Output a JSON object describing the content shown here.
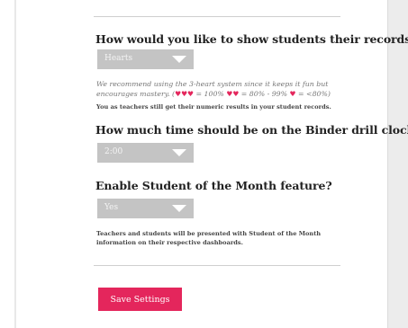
{
  "records": {
    "question": "How would you like to show students their records?",
    "selected": "Hearts",
    "hint_prefix": "We recommend using the 3-heart system since it keeps it fun but encourages mastery. (",
    "hearts_three": "♥♥♥",
    "range_three": " = 100% ",
    "hearts_two": "♥♥",
    "range_two": " = 80% - 99% ",
    "hearts_one": "♥",
    "range_one": " = <80%)",
    "note": "You as teachers still get their numeric results in your student records."
  },
  "drill_clock": {
    "question": "How much time should be on the Binder drill clock?",
    "selected": "2:00"
  },
  "student_of_month": {
    "question": "Enable Student of the Month feature?",
    "selected": "Yes",
    "note": "Teachers and students will be presented with Student of the Month information on their respective dashboards."
  },
  "actions": {
    "save_label": "Save Settings"
  },
  "colors": {
    "accent": "#e4265c",
    "select_bg": "#c4c4c4"
  },
  "icons": {
    "dropdown": "chevron-down-icon",
    "heart": "heart-icon"
  }
}
